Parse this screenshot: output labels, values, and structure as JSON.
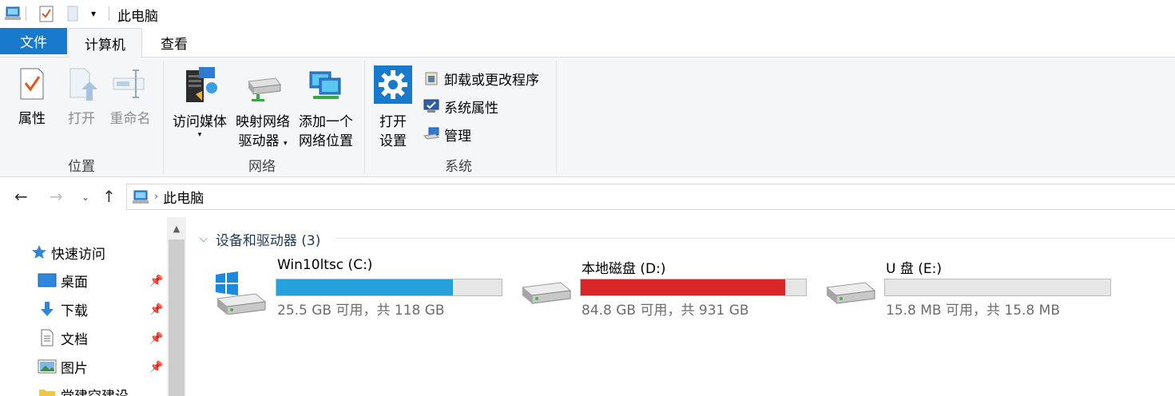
{
  "window": {
    "title": "此电脑"
  },
  "ribbon": {
    "tabs": {
      "file": "文件",
      "computer": "计算机",
      "view": "查看"
    },
    "location": {
      "label": "位置",
      "properties": "属性",
      "open": "打开",
      "rename": "重命名"
    },
    "network": {
      "label": "网络",
      "access_media": "访问媒体",
      "map_drive_line1": "映射网络",
      "map_drive_line2": "驱动器",
      "add_location_line1": "添加一个",
      "add_location_line2": "网络位置"
    },
    "system": {
      "label": "系统",
      "open_settings_line1": "打开",
      "open_settings_line2": "设置",
      "uninstall": "卸载或更改程序",
      "sys_props": "系统属性",
      "manage": "管理"
    }
  },
  "address": {
    "crumb": "此电脑"
  },
  "nav": {
    "quick_access": "快速访问",
    "items": [
      {
        "label": "桌面"
      },
      {
        "label": "下载"
      },
      {
        "label": "文档"
      },
      {
        "label": "图片"
      },
      {
        "label": "党建空建设"
      }
    ]
  },
  "content": {
    "section_title": "设备和驱动器 (3)",
    "drives": [
      {
        "name": "Win10ltsc (C:)",
        "free_text": "25.5 GB 可用，共 118 GB",
        "used_fraction": 0.784,
        "bar_color": "#26a0da"
      },
      {
        "name": "本地磁盘 (D:)",
        "free_text": "84.8 GB 可用，共 931 GB",
        "used_fraction": 0.909,
        "bar_color": "#da2626"
      },
      {
        "name": "U 盘 (E:)",
        "free_text": "15.8 MB 可用，共 15.8 MB",
        "used_fraction": 0.0,
        "bar_color": "#26a0da"
      }
    ]
  },
  "colors": {
    "accent": "#1979ca",
    "ribbon_bg": "#f5f6f7"
  }
}
